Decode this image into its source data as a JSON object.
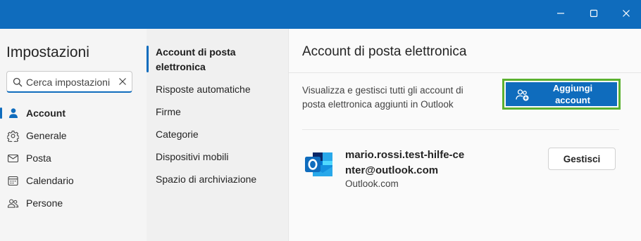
{
  "window": {
    "controls": [
      {
        "name": "minimize",
        "icon": "minimize-icon"
      },
      {
        "name": "maximize",
        "icon": "maximize-icon"
      },
      {
        "name": "close",
        "icon": "close-icon"
      }
    ],
    "titlebar_color": "#0f6cbd"
  },
  "sidebar": {
    "title": "Impostazioni",
    "search": {
      "placeholder": "Cerca impostazioni",
      "value": ""
    },
    "items": [
      {
        "label": "Account",
        "icon": "person-icon",
        "active": true
      },
      {
        "label": "Generale",
        "icon": "gear-icon",
        "active": false
      },
      {
        "label": "Posta",
        "icon": "mail-icon",
        "active": false
      },
      {
        "label": "Calendario",
        "icon": "calendar-icon",
        "active": false
      },
      {
        "label": "Persone",
        "icon": "people-icon",
        "active": false
      }
    ]
  },
  "subnav": {
    "items": [
      {
        "label": "Account di posta elettronica",
        "active": true
      },
      {
        "label": "Risposte automatiche",
        "active": false
      },
      {
        "label": "Firme",
        "active": false
      },
      {
        "label": "Categorie",
        "active": false
      },
      {
        "label": "Dispositivi mobili",
        "active": false
      },
      {
        "label": "Spazio di archiviazione",
        "active": false
      }
    ]
  },
  "main": {
    "title": "Account di posta elettronica",
    "description": "Visualizza e gestisci tutti gli account di posta elettronica aggiunti in Outlook",
    "add_button": {
      "label": "Aggiungi account",
      "icon": "add-people-icon",
      "highlight_color": "#5cb130"
    },
    "account": {
      "email": "mario.rossi.test-hilfe-center@outlook.com",
      "type": "Outlook.com",
      "logo": "outlook-logo-icon",
      "manage_label": "Gestisci"
    }
  },
  "colors": {
    "accent": "#0f6cbd"
  }
}
